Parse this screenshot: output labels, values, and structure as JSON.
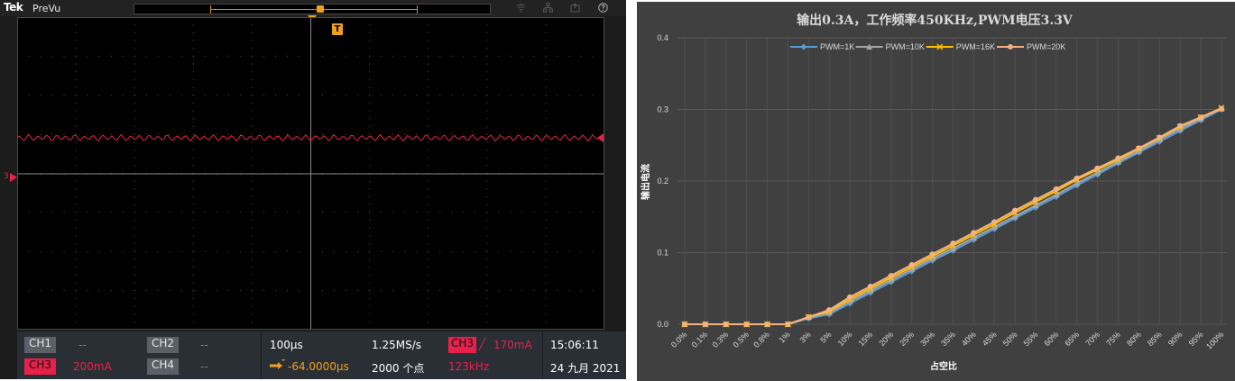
{
  "scope": {
    "brand": "Tek",
    "mode": "PreVu",
    "trigger_badge": "T",
    "channel_marker": "3",
    "status": {
      "ch1_label": "CH1",
      "ch1_value": "--",
      "ch2_label": "CH2",
      "ch2_value": "--",
      "ch3_label": "CH3",
      "ch3_value": "200mA",
      "ch4_label": "CH4",
      "ch4_value": "--",
      "timebase": "100µs",
      "delay": "-64.0000µs",
      "sample_rate": "1.25MS/s",
      "record_length": "2000 个点",
      "trigger_source": "CH3",
      "trigger_slope": "╱",
      "trigger_level": "170mA",
      "frequency": "123kHz",
      "time": "15:06:11",
      "date": "24 九月 2021"
    },
    "colors": {
      "trace": "#e8204a",
      "trigger": "#f0a020"
    }
  },
  "chart_data": {
    "type": "line",
    "title": "输出0.3A，工作频率450KHz,PWM电压3.3V",
    "xlabel": "占空比",
    "ylabel": "输出电流",
    "ylim": [
      0,
      0.4
    ],
    "yticks": [
      "0.0",
      "0.1",
      "0.2",
      "0.3",
      "0.4"
    ],
    "legend_position": "top",
    "grid": true,
    "categories": [
      "0.0%",
      "0.1%",
      "0.3%",
      "0.5%",
      "0.8%",
      "1%",
      "3%",
      "5%",
      "10%",
      "15%",
      "20%",
      "25%",
      "30%",
      "35%",
      "40%",
      "45%",
      "50%",
      "55%",
      "60%",
      "65%",
      "70%",
      "75%",
      "80%",
      "85%",
      "90%",
      "95%",
      "100%"
    ],
    "series": [
      {
        "name": "PWM=1K",
        "color": "#5b9bd5",
        "marker": "diamond",
        "values": [
          0,
          0,
          0,
          0,
          0,
          0,
          0.008,
          0.014,
          0.029,
          0.044,
          0.059,
          0.074,
          0.089,
          0.103,
          0.118,
          0.133,
          0.148,
          0.163,
          0.178,
          0.194,
          0.209,
          0.225,
          0.24,
          0.255,
          0.27,
          0.285,
          0.3
        ]
      },
      {
        "name": "PWM=10K",
        "color": "#a5a5a5",
        "marker": "triangle",
        "values": [
          0,
          0,
          0,
          0,
          0,
          0,
          0.01,
          0.016,
          0.032,
          0.047,
          0.062,
          0.077,
          0.092,
          0.106,
          0.121,
          0.136,
          0.151,
          0.166,
          0.181,
          0.197,
          0.212,
          0.227,
          0.242,
          0.258,
          0.273,
          0.287,
          0.301
        ]
      },
      {
        "name": "PWM=16K",
        "color": "#ffc000",
        "marker": "x",
        "values": [
          0,
          0,
          0,
          0,
          0,
          0,
          0.01,
          0.018,
          0.035,
          0.05,
          0.065,
          0.08,
          0.095,
          0.11,
          0.125,
          0.14,
          0.156,
          0.171,
          0.186,
          0.202,
          0.216,
          0.23,
          0.245,
          0.26,
          0.276,
          0.289,
          0.302
        ]
      },
      {
        "name": "PWM=20K",
        "color": "#f4b183",
        "marker": "circle",
        "values": [
          0,
          0,
          0,
          0,
          0,
          0,
          0.01,
          0.02,
          0.038,
          0.053,
          0.068,
          0.083,
          0.098,
          0.113,
          0.128,
          0.143,
          0.159,
          0.174,
          0.189,
          0.204,
          0.218,
          0.232,
          0.246,
          0.261,
          0.277,
          0.289,
          0.301
        ]
      }
    ]
  }
}
